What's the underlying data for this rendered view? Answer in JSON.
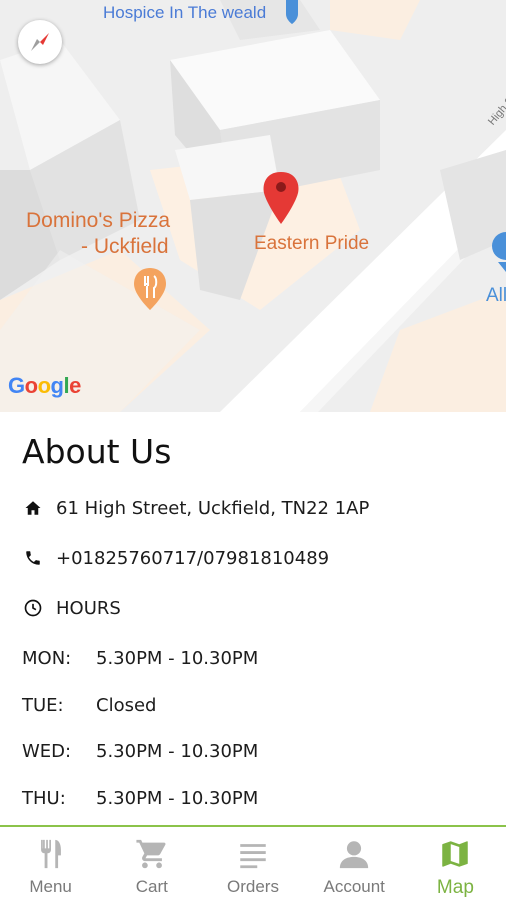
{
  "map": {
    "labels": {
      "hospice": "Hospice In The weald",
      "dominos_line1": "Domino's Pizza",
      "dominos_line2": "- Uckfield",
      "eastern": "Eastern Pride",
      "street": "High St",
      "partial": "All"
    },
    "attribution": "Google"
  },
  "about": {
    "title": "About Us",
    "address": "61 High Street, Uckfield, TN22 1AP",
    "phone": "+01825760717/07981810489",
    "hours_label": "HOURS",
    "hours": [
      {
        "day": "MON:",
        "time": "5.30PM - 10.30PM"
      },
      {
        "day": "TUE:",
        "time": "Closed"
      },
      {
        "day": "WED:",
        "time": "5.30PM - 10.30PM"
      },
      {
        "day": "THU:",
        "time": "5.30PM - 10.30PM"
      }
    ]
  },
  "nav": {
    "items": [
      {
        "label": "Menu",
        "icon": "cutlery-icon"
      },
      {
        "label": "Cart",
        "icon": "cart-icon"
      },
      {
        "label": "Orders",
        "icon": "list-icon"
      },
      {
        "label": "Account",
        "icon": "person-icon"
      },
      {
        "label": "Map",
        "icon": "map-icon"
      }
    ],
    "active": "Map",
    "active_color": "#7cb342"
  },
  "colors": {
    "marker": "#e53935",
    "poi_orange": "#d9733b",
    "poi_blue": "#4a90d9"
  }
}
